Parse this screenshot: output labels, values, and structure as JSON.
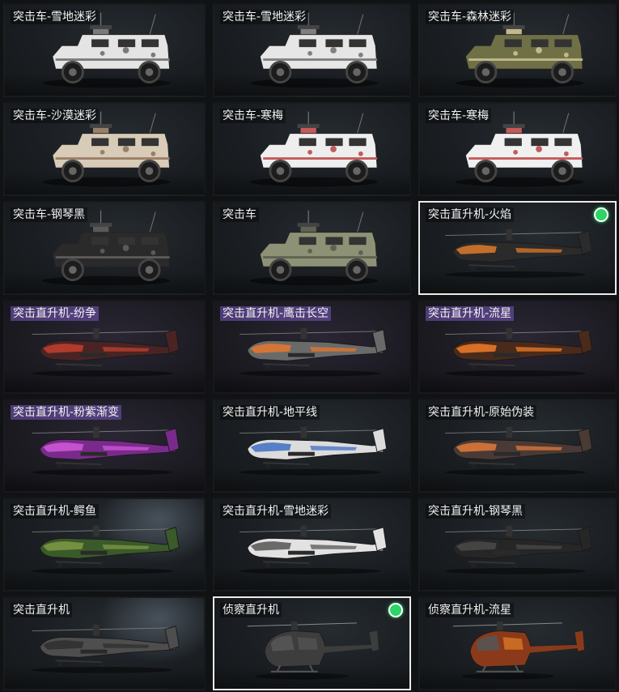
{
  "items": [
    {
      "label": "突击车-雪地迷彩",
      "kind": "car",
      "body": "#e4e4e4",
      "accent": "#7a7a7a",
      "theme": "dark",
      "equipped": false
    },
    {
      "label": "突击车-雪地迷彩",
      "kind": "car",
      "body": "#e6e6e6",
      "accent": "#808080",
      "theme": "dark",
      "equipped": false
    },
    {
      "label": "突击车-森林迷彩",
      "kind": "car",
      "body": "#6f7046",
      "accent": "#c2b98c",
      "theme": "dark",
      "equipped": false
    },
    {
      "label": "突击车-沙漠迷彩",
      "kind": "car",
      "body": "#d8cbb7",
      "accent": "#9a7f68",
      "theme": "dark",
      "equipped": false
    },
    {
      "label": "突击车-寒梅",
      "kind": "car",
      "body": "#eeeeee",
      "accent": "#c45a5a",
      "theme": "dark",
      "equipped": false
    },
    {
      "label": "突击车-寒梅",
      "kind": "car",
      "body": "#f0f0f0",
      "accent": "#c45a5a",
      "theme": "dark",
      "equipped": false
    },
    {
      "label": "突击车-钢琴黑",
      "kind": "car",
      "body": "#2a2a2a",
      "accent": "#5a5a5a",
      "theme": "dark",
      "equipped": false
    },
    {
      "label": "突击车",
      "kind": "car",
      "body": "#8d9276",
      "accent": "#5f6351",
      "theme": "dark",
      "equipped": false
    },
    {
      "label": "突击直升机-火焰",
      "kind": "heli",
      "body": "#2b2b2b",
      "accent": "#e07a2a",
      "theme": "dark",
      "equipped": true
    },
    {
      "label": "突击直升机-纷争",
      "kind": "heli",
      "body": "#4a2424",
      "accent": "#c2402f",
      "theme": "purple",
      "equipped": false
    },
    {
      "label": "突击直升机-鹰击长空",
      "kind": "heli",
      "body": "#6a6a6a",
      "accent": "#e8772c",
      "theme": "purple",
      "equipped": false
    },
    {
      "label": "突击直升机-流星",
      "kind": "heli",
      "body": "#4a2a1a",
      "accent": "#f07b2a",
      "theme": "purple",
      "equipped": false
    },
    {
      "label": "突击直升机-粉紫渐变",
      "kind": "heli",
      "body": "#7a2a8c",
      "accent": "#d05ad8",
      "theme": "purple",
      "equipped": false
    },
    {
      "label": "突击直升机-地平线",
      "kind": "heli",
      "body": "#dcdcdc",
      "accent": "#3f6fc4",
      "theme": "dark",
      "equipped": false
    },
    {
      "label": "突击直升机-原始伪装",
      "kind": "heli",
      "body": "#4a3a35",
      "accent": "#e27a3a",
      "theme": "dark",
      "equipped": false
    },
    {
      "label": "突击直升机-鳄鱼",
      "kind": "heli",
      "body": "#3a5a2a",
      "accent": "#7f9a44",
      "theme": "spot",
      "equipped": false
    },
    {
      "label": "突击直升机-雪地迷彩",
      "kind": "heli",
      "body": "#e2e2e2",
      "accent": "#555555",
      "theme": "dark",
      "equipped": false
    },
    {
      "label": "突击直升机-钢琴黑",
      "kind": "heli",
      "body": "#262626",
      "accent": "#4a4a4a",
      "theme": "dark",
      "equipped": false
    },
    {
      "label": "突击直升机",
      "kind": "heli",
      "body": "#4e4e4e",
      "accent": "#2f2f2f",
      "theme": "spot",
      "equipped": false
    },
    {
      "label": "侦察直升机",
      "kind": "scout",
      "body": "#3d3d3d",
      "accent": "#5a5a5a",
      "theme": "dark",
      "equipped": true
    },
    {
      "label": "侦察直升机-流星",
      "kind": "scout",
      "body": "#8a3a1a",
      "accent": "#f08a2a",
      "theme": "dark",
      "equipped": false
    }
  ]
}
